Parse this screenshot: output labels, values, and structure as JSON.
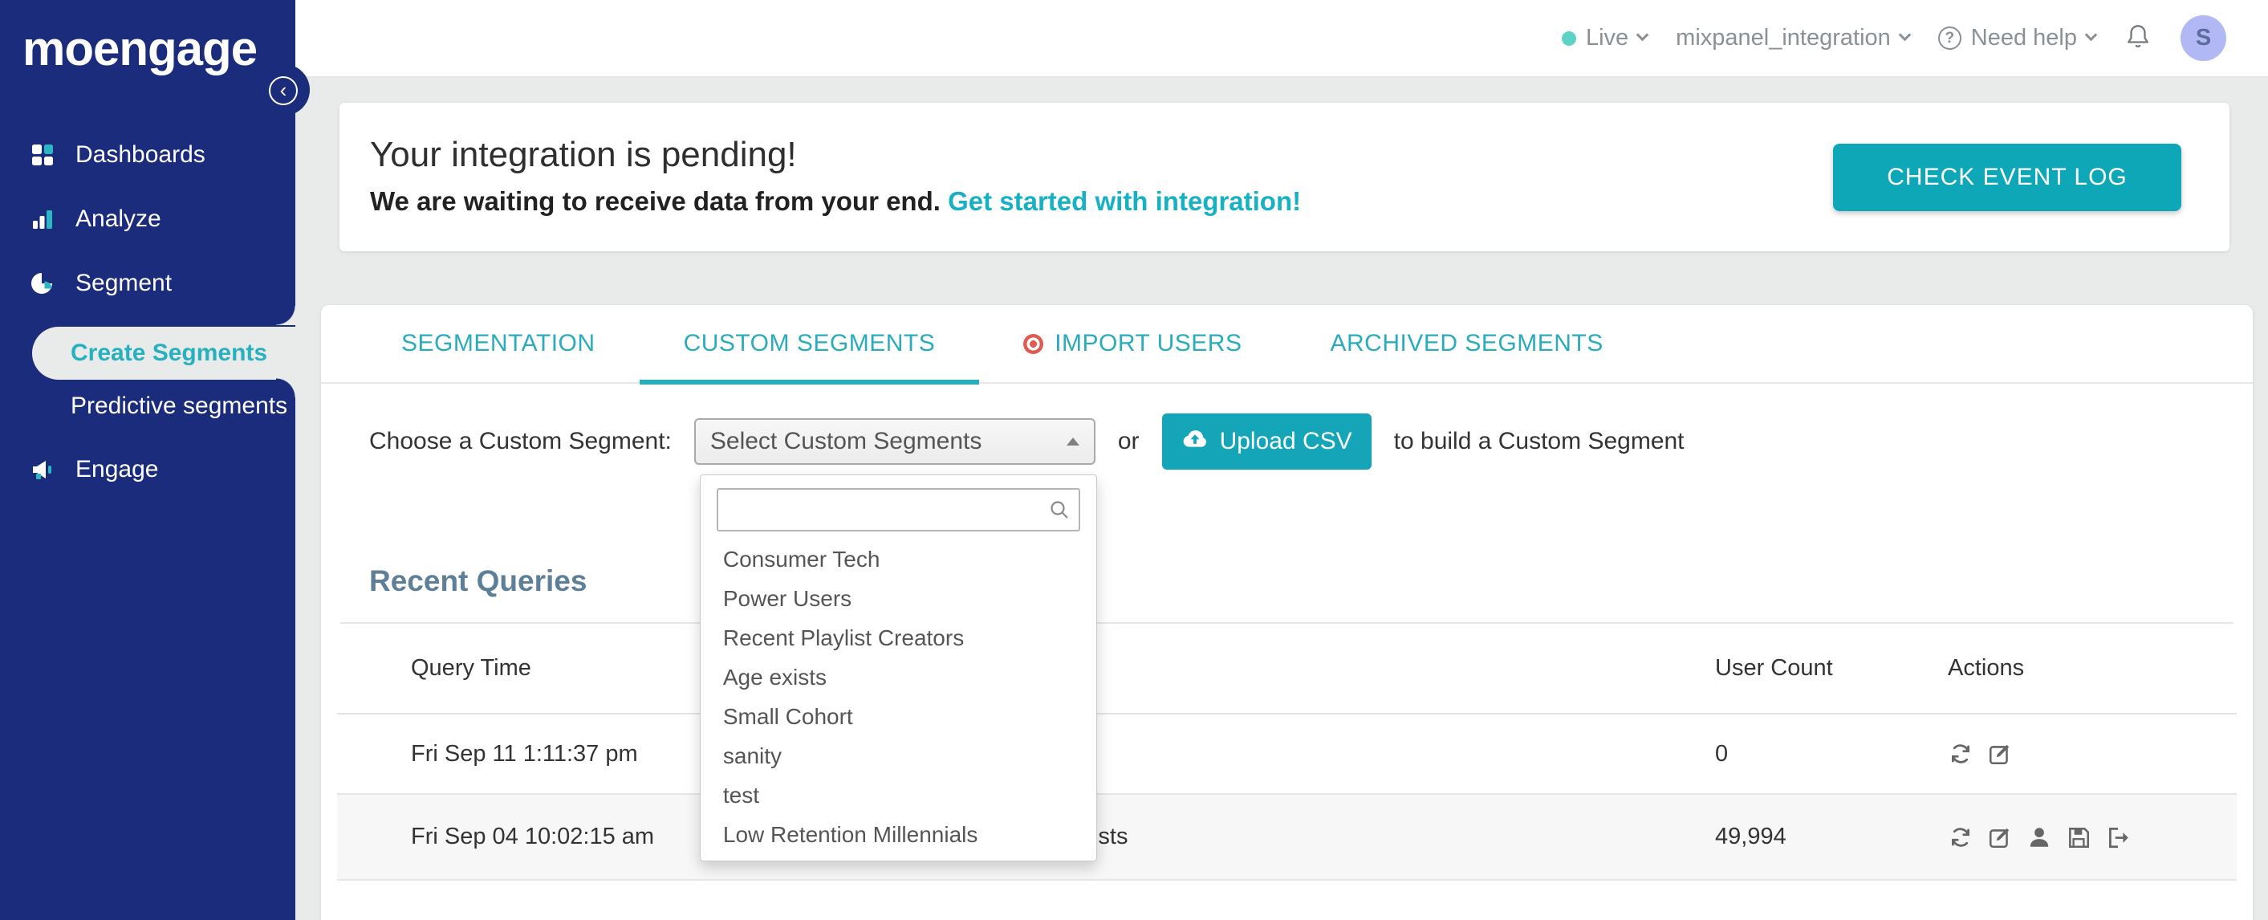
{
  "colors": {
    "sidebar_blue": "#1b2c7d",
    "accent_teal": "#14a5b8",
    "tab_teal": "#2aacbc",
    "link_teal": "#17b1c3",
    "live_dot_teal": "#5ed3c5",
    "import_badge_red": "#df5b52",
    "avatar_bg": "#b2b8f3",
    "page_bg": "#e9eaea",
    "heading_slate": "#5d7f97"
  },
  "sidebar": {
    "logo_text": "moengage",
    "collapse_glyph": "‹",
    "items": [
      {
        "label": "Dashboards",
        "icon": "grid-icon"
      },
      {
        "label": "Analyze",
        "icon": "bar-chart-icon"
      },
      {
        "label": "Segment",
        "icon": "pie-chart-icon"
      },
      {
        "label": "Engage",
        "icon": "megaphone-icon"
      }
    ],
    "segment_children": [
      {
        "label": "Create Segments",
        "active": true
      },
      {
        "label": "Predictive segments",
        "active": false
      }
    ]
  },
  "topbar": {
    "live_label": "Live",
    "project_name": "mixpanel_integration",
    "help_qmark": "?",
    "help_label": "Need help",
    "avatar_initial": "S"
  },
  "banner": {
    "title": "Your integration is pending!",
    "subtitle": "We are waiting to receive data from your end.",
    "link_label": "Get started with integration!",
    "button_label": "CHECK EVENT LOG"
  },
  "tabs": [
    {
      "label": "SEGMENTATION",
      "active": false
    },
    {
      "label": "CUSTOM SEGMENTS",
      "active": true
    },
    {
      "label": "IMPORT USERS",
      "active": false,
      "badge": "new-indicator"
    },
    {
      "label": "ARCHIVED SEGMENTS",
      "active": false
    }
  ],
  "segment_picker": {
    "label": "Choose a Custom Segment:",
    "select_value": "Select Custom Segments",
    "or_text": "or",
    "upload_button_label": "Upload CSV",
    "suffix_text": "to build a Custom Segment",
    "search_value": "",
    "options": [
      "Consumer Tech",
      "Power Users",
      "Recent Playlist Creators",
      "Age exists",
      "Small Cohort",
      "sanity",
      "test",
      "Low Retention Millennials"
    ]
  },
  "recent_queries": {
    "title": "Recent Queries",
    "header": {
      "time": "Query Time",
      "count": "User Count",
      "actions": "Actions"
    },
    "rows": [
      {
        "time": "Fri Sep 11 1:11:37 pm",
        "query": "",
        "count": "0",
        "actions": [
          "refresh",
          "edit"
        ]
      },
      {
        "time": "Fri Sep 04 10:02:15 am",
        "query": "Users in custom segment: Age exists",
        "count": "49,994",
        "actions": [
          "refresh",
          "edit",
          "user",
          "save",
          "export"
        ]
      }
    ]
  }
}
